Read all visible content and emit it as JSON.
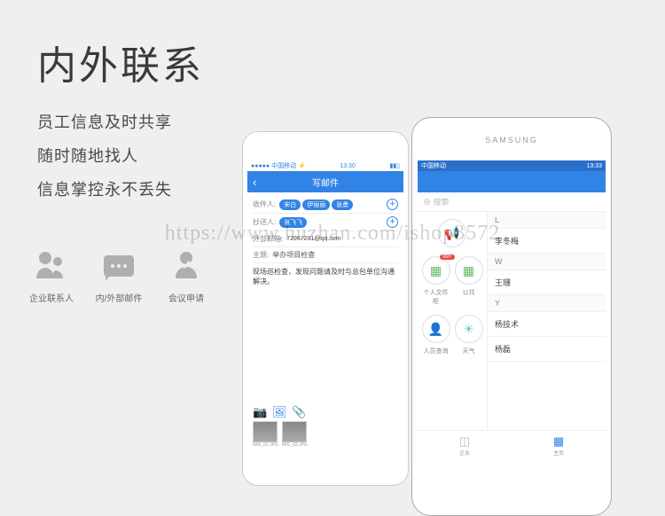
{
  "page": {
    "title": "内外联系",
    "subtitles": [
      "员工信息及时共享",
      "随时随地找人",
      "信息掌控永不丢失"
    ]
  },
  "features": [
    {
      "label": "企业联系人"
    },
    {
      "label": "内/外部邮件"
    },
    {
      "label": "会议申请"
    }
  ],
  "ios": {
    "status": {
      "carrier": "●●●●● 中国移动 ⚡",
      "time": "13:30",
      "battery": "▮▮▯"
    },
    "header_title": "写邮件",
    "recipients": {
      "label": "收件人:",
      "chips": [
        "宋白",
        "伊丽丽",
        "张勇"
      ]
    },
    "cc": {
      "label": "抄送人:",
      "chips": [
        "张飞飞"
      ]
    },
    "external": {
      "label": "外部邮箱:",
      "value": "72967201@qq.com"
    },
    "subject": {
      "label": "主题:",
      "value": "举办项目检查"
    },
    "body": "现场巡检查，发现问题请及时与总包单位沟通解决。",
    "attachments": [
      "IMG_01.JPG",
      "IMG_02.JPG"
    ]
  },
  "android": {
    "brand": "SAMSUNG",
    "status": {
      "carrier": "中国移动",
      "time": "13:33"
    },
    "search_placeholder": "⊕ 搜索",
    "apps": [
      {
        "label": "",
        "color": "#e88",
        "glyph": "📢"
      },
      {
        "label": "个人文件柜",
        "color": "#6b6",
        "glyph": "▦",
        "badge": "99+"
      },
      {
        "label": "公共",
        "color": "#6b6",
        "glyph": "▦"
      },
      {
        "label": "人员查询",
        "color": "#6c9",
        "glyph": "👤"
      },
      {
        "label": "天气",
        "color": "#6cc",
        "glyph": "☀"
      }
    ],
    "contacts": [
      {
        "type": "section",
        "text": "L"
      },
      {
        "type": "item",
        "text": "李冬梅"
      },
      {
        "type": "section",
        "text": "W"
      },
      {
        "type": "item",
        "text": "王珊"
      },
      {
        "type": "section",
        "text": "Y"
      },
      {
        "type": "item",
        "text": "杨技术"
      },
      {
        "type": "item",
        "text": "杨磊"
      }
    ],
    "nav": [
      {
        "label": "企业"
      },
      {
        "label": "主页"
      }
    ]
  },
  "watermark": "https://www.huzhan.com/ishop3572"
}
